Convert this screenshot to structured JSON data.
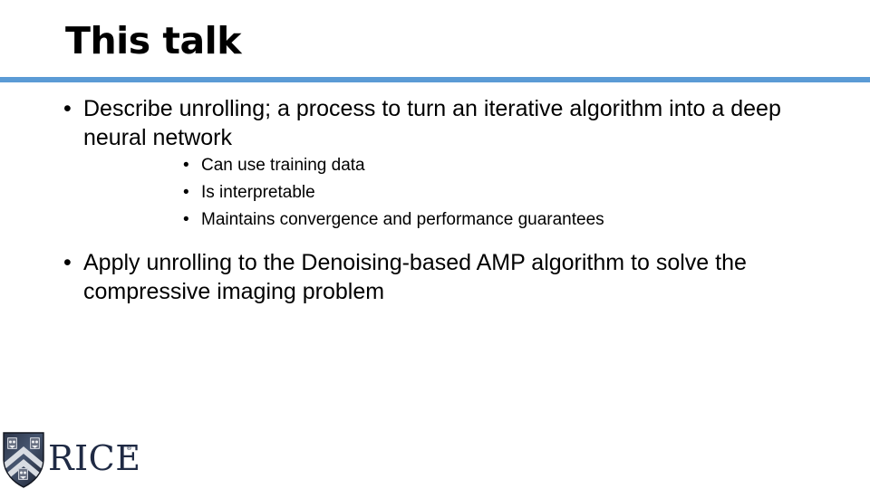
{
  "slide": {
    "title": "This talk",
    "accent_color": "#5B9BD5",
    "text_color": "#000000",
    "background_color": "#FFFFFF"
  },
  "bullets": [
    {
      "level": 1,
      "marker": "•",
      "text": "Describe unrolling; a process to turn an iterative algorithm into a deep neural network",
      "children": [
        {
          "level": 2,
          "marker": "•",
          "text": "Can use training data"
        },
        {
          "level": 2,
          "marker": "•",
          "text": "Is interpretable"
        },
        {
          "level": 2,
          "marker": "•",
          "text": "Maintains convergence and performance guarantees"
        }
      ]
    },
    {
      "level": 1,
      "marker": "•",
      "text": "Apply unrolling to the Denoising-based AMP algorithm to solve the compressive imaging problem",
      "children": []
    }
  ],
  "logo": {
    "wordmark": "RICE",
    "trademark": "®",
    "shield_color_dark": "#232A3B",
    "shield_color_mid": "#3C4B66",
    "chevron_color": "#D8DCE2",
    "wordmark_color": "#1F2A44"
  }
}
